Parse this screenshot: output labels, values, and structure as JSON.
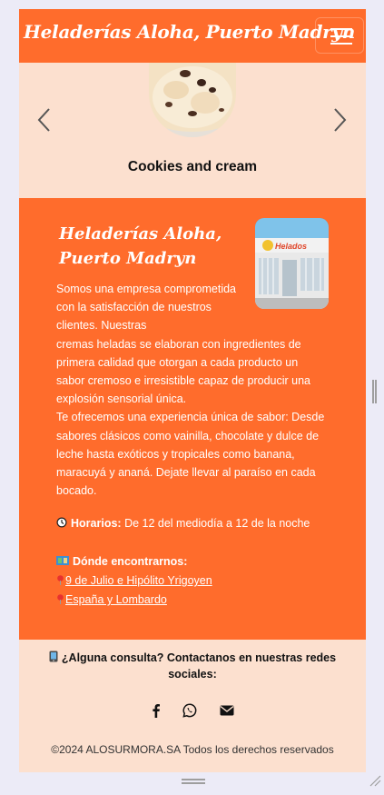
{
  "navbar": {
    "brand": "Heladerías Aloha, Puerto Madryn",
    "toggle_icon": "hamburger-menu-icon"
  },
  "carousel": {
    "current_flavor": "Cookies and cream",
    "prev_icon": "chevron-left-icon",
    "next_icon": "chevron-right-icon"
  },
  "about": {
    "title_line1": "Heladerías Aloha,",
    "title_line2": "Puerto Madryn",
    "store_sign": "Helados",
    "intro": "Somos una empresa comprometida con la satisfacción de nuestros clientes. Nuestras",
    "para1_rest": "cremas heladas se elaboran con ingredientes de primera calidad que otorgan a cada producto un sabor cremoso e irresistible capaz de producir una explosión sensorial única.",
    "para2": "Te ofrecemos una experiencia única de sabor: Desde sabores clásicos como vainilla, chocolate y dulce de leche hasta exóticos y tropicales como banana, maracuyá y ananá. Dejate llevar al paraíso en cada bocado.",
    "hours_label": "Horarios:",
    "hours_value": "De 12 del mediodía a 12 de la noche",
    "where_label": "Dónde encontrarnos:",
    "locations": [
      "9 de Julio e Hipólito Yrigoyen",
      "España y Lombardo"
    ]
  },
  "footer": {
    "contact": "¿Alguna consulta? Contactanos en nuestras redes sociales:",
    "socials": [
      "facebook-icon",
      "whatsapp-icon",
      "email-icon"
    ],
    "copyright": "©2024 ALOSURMORA.SA Todos los derechos reservados"
  },
  "colors": {
    "primary": "#ff6c2c",
    "light": "#fce0cf",
    "background": "#ecebf7"
  }
}
